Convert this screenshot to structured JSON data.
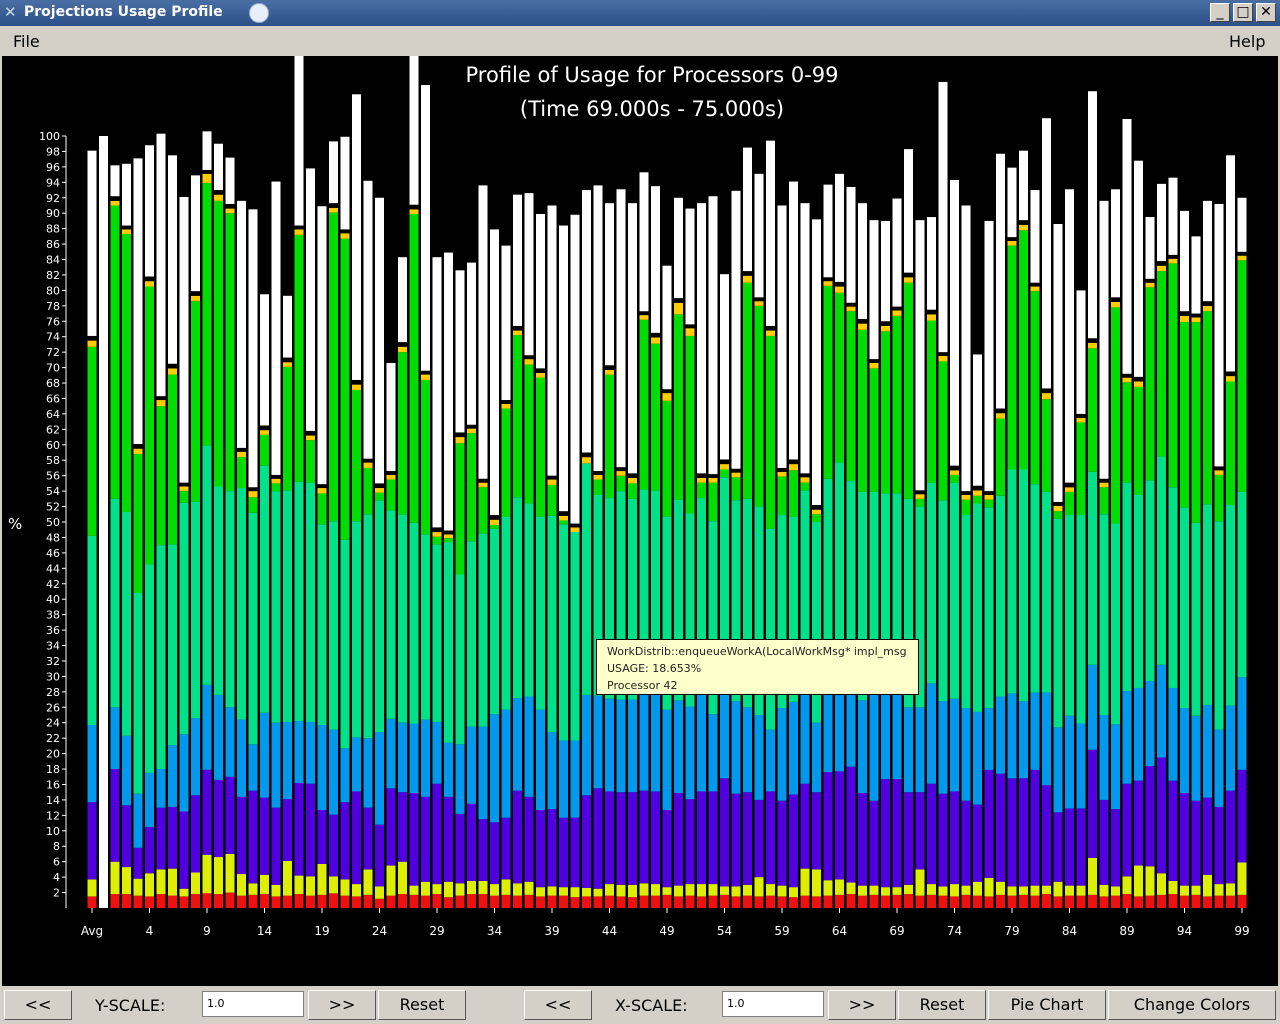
{
  "window": {
    "title": "Projections Usage Profile"
  },
  "menu": {
    "file": "File",
    "help": "Help"
  },
  "colors": {
    "background": "#000000",
    "segments": [
      "#ee1111",
      "#ddee00",
      "#5000e0",
      "#0099ee",
      "#00e28a",
      "#00dd00",
      "#ffcc00",
      "#000000",
      "#ffffff"
    ]
  },
  "chart_data": {
    "type": "bar",
    "stacked": true,
    "title": "Profile of Usage for Processors 0-99",
    "subtitle": "(Time 69.000s - 75.000s)",
    "ylabel": "%",
    "ylim": [
      0,
      100
    ],
    "yticks": [
      2,
      4,
      6,
      8,
      10,
      12,
      14,
      16,
      18,
      20,
      22,
      24,
      26,
      28,
      30,
      32,
      34,
      36,
      38,
      40,
      42,
      44,
      46,
      48,
      50,
      52,
      54,
      56,
      58,
      60,
      62,
      64,
      66,
      68,
      70,
      72,
      74,
      76,
      78,
      80,
      82,
      84,
      86,
      88,
      90,
      92,
      94,
      96,
      98,
      100
    ],
    "xtick_labels": [
      "Avg",
      "4",
      "9",
      "14",
      "19",
      "24",
      "29",
      "34",
      "39",
      "44",
      "49",
      "54",
      "59",
      "64",
      "69",
      "74",
      "79",
      "84",
      "89",
      "94",
      "99"
    ],
    "categories": [
      "Avg",
      "0",
      "1",
      "2",
      "3",
      "4",
      "5",
      "6",
      "7",
      "8",
      "9",
      "10",
      "11",
      "12",
      "13",
      "14",
      "15",
      "16",
      "17",
      "18",
      "19",
      "20",
      "21",
      "22",
      "23",
      "24",
      "25",
      "26",
      "27",
      "28",
      "29",
      "30",
      "31",
      "32",
      "33",
      "34",
      "35",
      "36",
      "37",
      "38",
      "39",
      "40",
      "41",
      "42",
      "43",
      "44",
      "45",
      "46",
      "47",
      "48",
      "49",
      "50",
      "51",
      "52",
      "53",
      "54",
      "55",
      "56",
      "57",
      "58",
      "59",
      "60",
      "61",
      "62",
      "63",
      "64",
      "65",
      "66",
      "67",
      "68",
      "69",
      "70",
      "71",
      "72",
      "73",
      "74",
      "75",
      "76",
      "77",
      "78",
      "79",
      "80",
      "81",
      "82",
      "83",
      "84",
      "85",
      "86",
      "87",
      "88",
      "89",
      "90",
      "91",
      "92",
      "93",
      "94",
      "95",
      "96",
      "97",
      "98",
      "99"
    ],
    "series": [
      {
        "values": [
          1.5,
          0,
          1.8,
          1.8,
          1.6,
          1.5,
          1.8,
          1.6,
          1.5,
          1.8,
          1.9,
          1.8,
          2,
          1.6,
          1.7,
          1.8,
          1.5,
          1.6,
          1.8,
          1.6,
          1.7,
          1.9,
          1.6,
          1.5,
          1.7,
          1.2,
          1.6,
          1.8,
          1.7,
          1.6,
          1.8,
          1.4,
          1.6,
          1.8,
          1.8,
          1.6,
          1.7,
          1.6,
          1.7,
          1.5,
          1.6,
          1.6,
          1.4,
          1.5,
          1.5,
          1.6,
          1.5,
          1.4,
          1.6,
          1.6,
          1.7,
          1.5,
          1.6,
          1.5,
          1.6,
          1.7,
          1.5,
          1.6,
          1.5,
          1.6,
          1.5,
          1.4,
          1.6,
          1.5,
          1.6,
          1.7,
          1.8,
          1.6,
          1.7,
          1.6,
          1.7,
          1.8,
          1.6,
          1.7,
          1.6,
          1.5,
          1.7,
          1.6,
          1.5,
          1.7,
          1.6,
          1.7,
          1.6,
          1.8,
          1.5,
          1.6,
          1.6,
          1.7,
          1.5,
          1.6,
          1.8,
          1.5,
          1.6,
          1.7,
          1.8,
          1.6,
          1.7,
          1.5,
          1.6,
          1.6,
          1.7
        ]
      },
      {
        "values": [
          2.2,
          0,
          4.2,
          3.5,
          2.2,
          3,
          3.2,
          3.5,
          1,
          2.8,
          5,
          4.8,
          5,
          2.8,
          1.5,
          2.5,
          1.5,
          4.5,
          2.4,
          2.5,
          4,
          2.2,
          2.1,
          1.6,
          3.3,
          1.6,
          3.9,
          4.2,
          1.2,
          1.8,
          1.3,
          2,
          1.6,
          1.7,
          1.7,
          1.5,
          2,
          1.6,
          1.7,
          1.2,
          1.2,
          1.1,
          1.3,
          1.1,
          1,
          1.5,
          1.5,
          1.6,
          1.6,
          1.5,
          1,
          1.4,
          1.5,
          1.6,
          1.5,
          1.1,
          1.3,
          1.4,
          2.5,
          1.5,
          1.4,
          1.3,
          3.5,
          3.5,
          2,
          2,
          1.5,
          1.3,
          1.2,
          1.1,
          1,
          1.2,
          3.4,
          1.4,
          1.2,
          1.6,
          1.2,
          1.8,
          2.4,
          1.7,
          1.2,
          1.1,
          1.3,
          1.1,
          1.9,
          1.3,
          1.3,
          4.8,
          1.5,
          1.2,
          2.3,
          4,
          3.8,
          2.8,
          1.7,
          1.3,
          1.2,
          2.8,
          1.5,
          1.6,
          4.2
        ]
      },
      {
        "values": [
          10,
          0,
          12,
          8,
          4,
          6,
          8,
          8,
          10,
          10,
          11,
          10,
          10,
          10,
          12,
          10,
          10,
          8,
          12,
          12,
          7,
          8,
          10,
          12,
          8,
          8,
          10,
          9,
          12,
          11,
          13,
          11,
          9,
          10,
          8,
          8,
          8,
          12,
          11,
          10,
          10,
          9,
          9,
          12,
          13,
          12,
          12,
          12,
          12,
          12,
          10,
          12,
          11,
          12,
          12,
          14,
          12,
          12,
          10,
          12,
          11,
          12,
          11,
          10,
          14,
          14,
          15,
          12,
          11,
          14,
          14,
          12,
          10,
          13,
          12,
          12,
          11,
          10,
          14,
          14,
          14,
          14,
          15,
          13,
          9,
          10,
          10,
          14,
          11,
          10,
          12,
          11,
          13,
          15,
          13,
          12,
          11,
          10,
          10,
          12,
          12
        ]
      },
      {
        "values": [
          10,
          0,
          8,
          9,
          7,
          7,
          5,
          8,
          10,
          10,
          11,
          11,
          9,
          10,
          6,
          11,
          11,
          10,
          8,
          8,
          11,
          11,
          7,
          7,
          9,
          12,
          9,
          9,
          9,
          10,
          8,
          7,
          9,
          10,
          12,
          14,
          14,
          12,
          13,
          13,
          10,
          10,
          10,
          13,
          12,
          12,
          12,
          12,
          13,
          14,
          13,
          12,
          12,
          13,
          10,
          15,
          12,
          11,
          11,
          8,
          12,
          12,
          13,
          9,
          12,
          13,
          11,
          12,
          14,
          11,
          11,
          11,
          11,
          13,
          12,
          12,
          12,
          12,
          8,
          10,
          11,
          10,
          10,
          12,
          11,
          12,
          11,
          11,
          11,
          11,
          12,
          12,
          11,
          12,
          12,
          11,
          11,
          12,
          10,
          11,
          12
        ]
      },
      {
        "values": [
          24.5,
          0,
          27,
          29,
          26,
          27,
          29,
          26,
          30,
          28,
          31,
          27,
          28,
          30,
          30,
          32,
          30,
          30,
          31,
          31,
          26,
          27,
          27,
          28,
          29,
          30,
          27,
          27,
          26,
          24,
          23,
          26,
          22,
          24,
          25,
          24,
          25,
          26,
          25,
          25,
          28,
          28,
          27,
          30,
          26,
          26,
          27,
          26,
          26,
          25,
          25,
          26,
          25,
          25,
          25,
          24,
          26,
          27,
          27,
          26,
          25,
          24,
          25,
          26,
          26,
          27,
          26,
          27,
          26,
          26,
          26,
          27,
          26,
          26,
          26,
          28,
          25,
          27,
          26,
          26,
          29,
          30,
          27,
          26,
          27,
          26,
          27,
          25,
          26,
          26,
          27,
          25,
          26,
          27,
          26,
          26,
          25,
          26,
          27,
          26,
          24
        ]
      },
      {
        "values": [
          24.5,
          0,
          38,
          36,
          18,
          36,
          18,
          22,
          1.5,
          26,
          34,
          37,
          36,
          4,
          2,
          4,
          1,
          16,
          32,
          5.5,
          4,
          40,
          39,
          17,
          6,
          1,
          4,
          21,
          40,
          20,
          1,
          0.5,
          17,
          14,
          6,
          0.5,
          14,
          21,
          18,
          18,
          4,
          0.5,
          0,
          0,
          2,
          16,
          2,
          2,
          22,
          19,
          15,
          24,
          23,
          2,
          5,
          1,
          3,
          28,
          26,
          25,
          5,
          6,
          1,
          1,
          25,
          22,
          22,
          21,
          16,
          21,
          23,
          28,
          1,
          21,
          18,
          1,
          2,
          1,
          1,
          10,
          29,
          31,
          25,
          12,
          1,
          3,
          12,
          16,
          3.5,
          28,
          13,
          14,
          25,
          24,
          29,
          24,
          26,
          25,
          6,
          16,
          30
        ]
      },
      {
        "values": [
          0.8,
          0,
          0.6,
          0.6,
          0.7,
          0.7,
          0.8,
          0.8,
          0.6,
          0.7,
          1.2,
          0.8,
          0.6,
          0.7,
          0.8,
          0.6,
          0.6,
          0.6,
          0.7,
          0.6,
          0.7,
          0.6,
          0.7,
          0.7,
          0.7,
          0.6,
          0.6,
          0.7,
          0.6,
          0.7,
          0.6,
          0.5,
          0.8,
          0.6,
          0.6,
          0.7,
          0.6,
          0.6,
          0.7,
          0.6,
          0.7,
          0.6,
          0.6,
          0.8,
          0.6,
          0.6,
          0.6,
          0.7,
          0.6,
          0.8,
          1,
          1.5,
          1,
          0.6,
          0.6,
          0.7,
          0.6,
          0.9,
          0.6,
          0.7,
          0.6,
          0.8,
          0.7,
          0.6,
          0.6,
          0.8,
          0.6,
          0.8,
          0.7,
          0.7,
          0.7,
          0.7,
          0.6,
          0.8,
          0.7,
          0.6,
          0.6,
          0.7,
          0.6,
          0.7,
          0.6,
          0.7,
          0.6,
          0.8,
          0.7,
          0.6,
          0.6,
          0.7,
          0.6,
          0.7,
          0.6,
          0.7,
          0.6,
          0.7,
          0.6,
          0.8,
          0.6,
          0.7,
          0.6,
          0.7,
          0.6
        ]
      },
      {
        "values": [
          0.6,
          0,
          0.6,
          0.5,
          0.6,
          0.6,
          0.5,
          0.6,
          0.5,
          0.6,
          0.5,
          0.6,
          0.6,
          0.5,
          0.5,
          0.6,
          0.5,
          0.6,
          0.5,
          0.6,
          0.5,
          0.6,
          0.5,
          0.6,
          0.5,
          0.6,
          0.5,
          0.6,
          0.6,
          0.5,
          0.6,
          0.5,
          0.6,
          0.5,
          0.5,
          0.6,
          0.5,
          0.6,
          0.5,
          0.6,
          0.5,
          0.6,
          0.5,
          0.6,
          0.5,
          0.6,
          0.5,
          0.6,
          0.5,
          0.6,
          0.5,
          0.6,
          0.5,
          0.6,
          0.5,
          0.6,
          0.5,
          0.6,
          0.5,
          0.6,
          0.5,
          0.6,
          0.5,
          0.6,
          0.5,
          0.6,
          0.5,
          0.6,
          0.5,
          0.6,
          0.5,
          0.6,
          0.5,
          0.6,
          0.5,
          0.6,
          0.5,
          0.6,
          0.5,
          0.6,
          0.5,
          0.6,
          0.5,
          0.6,
          0.5,
          0.6,
          0.5,
          0.6,
          0.5,
          0.6,
          0.5,
          0.6,
          0.5,
          0.6,
          0.5,
          0.6,
          0.5,
          0.6,
          0.5,
          0.6,
          0.5
        ]
      },
      {
        "values": [
          24,
          100,
          4,
          8,
          37,
          17,
          34,
          27,
          37,
          15,
          5,
          6,
          6,
          32,
          36,
          17,
          38,
          8,
          34,
          34,
          36,
          8,
          12,
          37,
          36,
          37,
          14,
          11,
          38,
          37,
          35,
          36,
          21,
          21,
          38,
          37,
          20,
          17,
          21,
          20,
          35,
          37,
          40,
          34,
          37,
          21,
          36,
          35,
          18,
          19,
          16,
          13,
          15,
          35,
          36,
          24,
          36,
          16,
          16,
          24,
          34,
          36,
          35,
          37,
          12,
          14,
          15,
          15,
          18,
          13,
          14,
          16,
          35,
          12,
          35,
          37,
          37,
          17,
          35,
          33,
          9,
          9,
          12,
          35,
          36,
          38,
          16,
          32,
          36,
          14,
          33,
          28,
          8,
          10,
          10,
          13,
          10,
          13,
          34,
          28,
          7
        ]
      }
    ],
    "tooltip": {
      "line1": "WorkDistrib::enqueueWorkA(LocalWorkMsg* impl_msg",
      "line2": "USAGE: 18.653%",
      "line3": "Processor 42"
    }
  },
  "controls": {
    "y_prev": "<<",
    "y_label": "Y-SCALE:",
    "y_value": "1.0",
    "y_next": ">>",
    "y_reset": "Reset",
    "x_prev": "<<",
    "x_label": "X-SCALE:",
    "x_value": "1.0",
    "x_next": ">>",
    "x_reset": "Reset",
    "pie_chart": "Pie Chart",
    "change_colors": "Change Colors"
  }
}
